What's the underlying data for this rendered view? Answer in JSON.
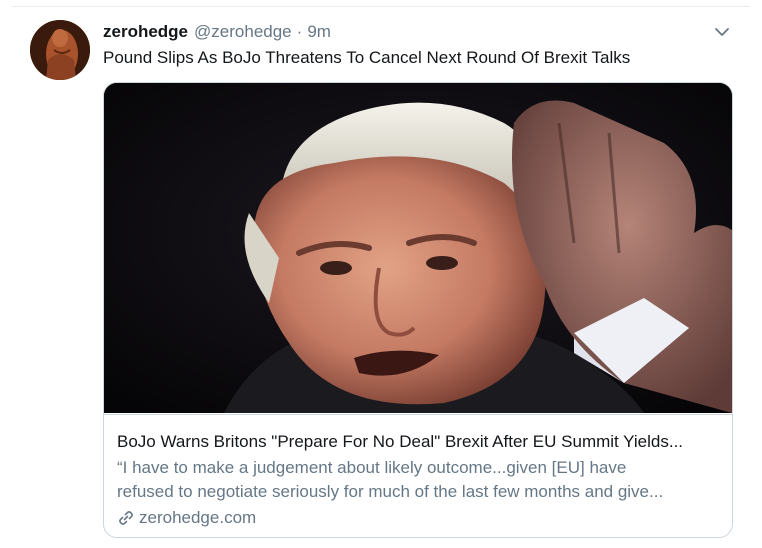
{
  "tweet": {
    "display_name": "zerohedge",
    "handle": "@zerohedge",
    "separator": "·",
    "time": "9m",
    "text": "Pound Slips As BoJo Threatens To Cancel Next Round Of Brexit Talks",
    "avatar_icon": "avatar-photo",
    "caret_icon": "chevron-down-icon"
  },
  "card": {
    "title": "BoJo Warns Britons \"Prepare For No Deal\" Brexit After EU Summit Yields...",
    "description_lines": [
      "“I have to make a judgement about likely outcome...given [EU] have",
      "refused to negotiate seriously for much of the last few months and give..."
    ],
    "domain": "zerohedge.com",
    "domain_icon": "link-icon"
  },
  "colors": {
    "primary_text": "#14171a",
    "secondary_text": "#657786",
    "border": "#ccd6dd",
    "accent": "#1da1f2"
  }
}
